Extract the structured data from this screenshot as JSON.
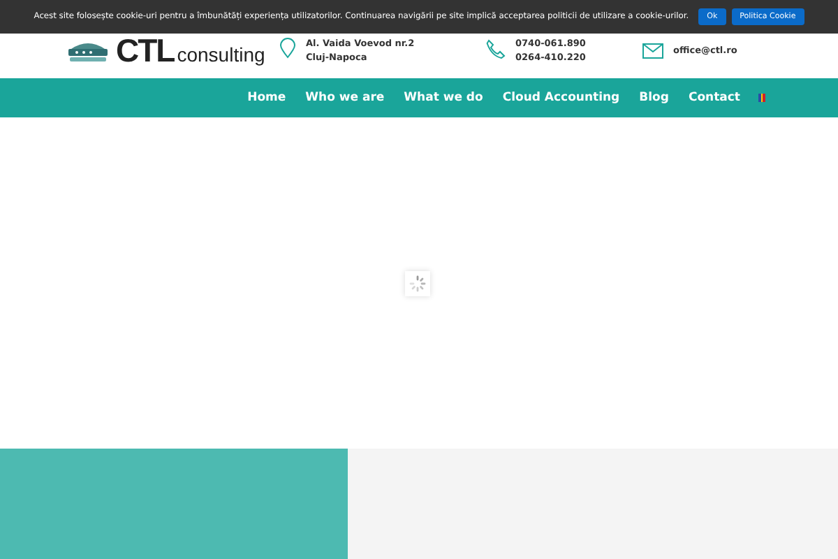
{
  "cookie_bar": {
    "message": "Acest site folosește cookie-uri pentru a îmbunătăți experiența utilizatorilor. Continuarea navigării pe site implică acceptarea politicii de utilizare a cookie-urilor.",
    "buttons": [
      "Ok",
      "Politica Cookie"
    ]
  },
  "logo": {
    "name": "CTL",
    "tagline": "consulting"
  },
  "contacts": [
    {
      "kind": "address",
      "lines": [
        "Al. Vaida Voevod nr.2",
        "Cluj-Napoca"
      ]
    },
    {
      "kind": "phone",
      "lines": [
        "0740-061.890",
        "0264-410.220"
      ]
    },
    {
      "kind": "email",
      "lines": [
        "office@ctl.ro"
      ]
    }
  ],
  "nav": [
    {
      "label": "Home"
    },
    {
      "label": "Who we are"
    },
    {
      "label": "What we do"
    },
    {
      "label": "Cloud Accounting"
    },
    {
      "label": "Blog"
    },
    {
      "label": "Contact"
    }
  ]
}
